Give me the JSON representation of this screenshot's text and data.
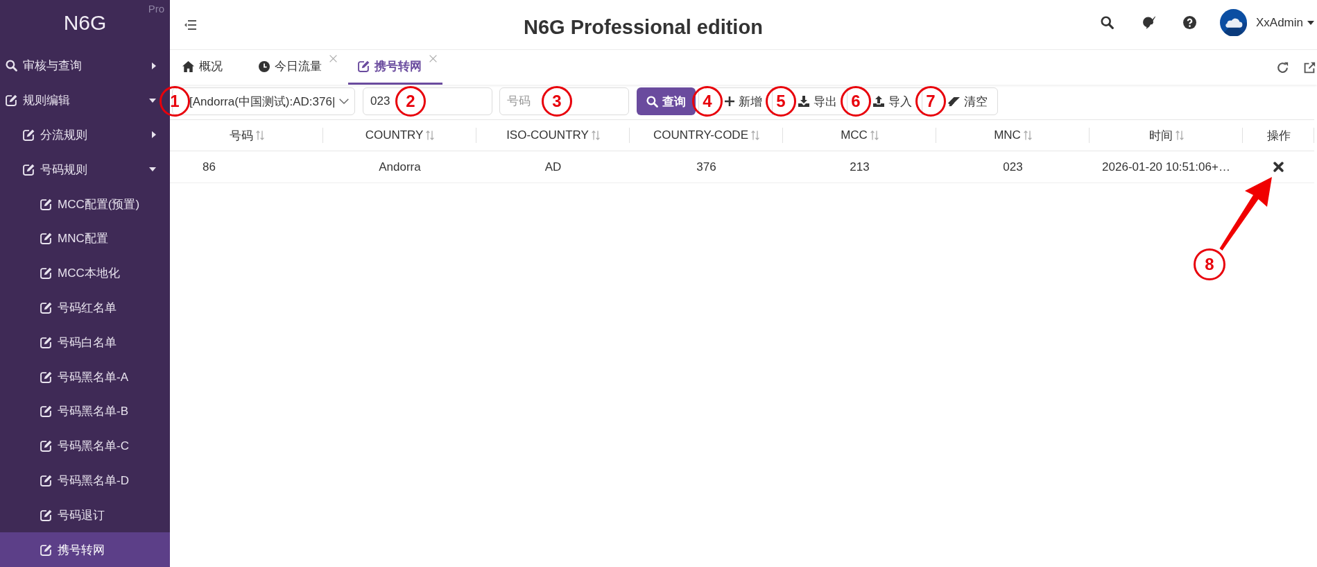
{
  "sidebar": {
    "logo": "N6G",
    "edition": "Pro",
    "items": [
      {
        "label": "审核与查询",
        "expanded": false,
        "selected": false
      },
      {
        "label": "规则编辑",
        "expanded": true,
        "selected": false,
        "children": [
          {
            "label": "分流规则",
            "expanded": false,
            "selected": false
          },
          {
            "label": "号码规则",
            "expanded": true,
            "selected": false,
            "children": [
              {
                "label": "MCC配置(预置)",
                "selected": false
              },
              {
                "label": "MNC配置",
                "selected": false
              },
              {
                "label": "MCC本地化",
                "selected": false
              },
              {
                "label": "号码红名单",
                "selected": false
              },
              {
                "label": "号码白名单",
                "selected": false
              },
              {
                "label": "号码黑名单-A",
                "selected": false
              },
              {
                "label": "号码黑名单-B",
                "selected": false
              },
              {
                "label": "号码黑名单-C",
                "selected": false
              },
              {
                "label": "号码黑名单-D",
                "selected": false
              },
              {
                "label": "号码退订",
                "selected": false
              },
              {
                "label": "携号转网",
                "selected": true
              }
            ]
          }
        ]
      }
    ]
  },
  "header": {
    "title": "N6G Professional edition",
    "user": "XxAdmin"
  },
  "tabs": [
    {
      "label": "概况",
      "selected": false,
      "closable": false
    },
    {
      "label": "今日流量",
      "selected": false,
      "closable": true
    },
    {
      "label": "携号转网",
      "selected": true,
      "closable": true
    }
  ],
  "toolbar": {
    "fields": [
      {
        "kind": "select",
        "value": "[Andorra(中国测试):AD:376|",
        "callout": "1"
      },
      {
        "kind": "input",
        "value": "023",
        "callout": "2"
      },
      {
        "kind": "input",
        "placeholder": "号码",
        "callout": "3"
      }
    ],
    "buttons": [
      {
        "kind": "primary",
        "label": "查询"
      },
      {
        "kind": "plain",
        "label": "新增",
        "callout": "4"
      },
      {
        "kind": "plain",
        "label": "导出",
        "callout": "5"
      },
      {
        "kind": "plain",
        "label": "导入",
        "callout": "6"
      },
      {
        "kind": "plain",
        "label": "清空",
        "callout": "7"
      }
    ]
  },
  "table": {
    "columns": [
      {
        "label": "号码",
        "sortable": true
      },
      {
        "label": "COUNTRY",
        "sortable": true
      },
      {
        "label": "ISO-COUNTRY",
        "sortable": true
      },
      {
        "label": "COUNTRY-CODE",
        "sortable": true
      },
      {
        "label": "MCC",
        "sortable": true
      },
      {
        "label": "MNC",
        "sortable": true
      },
      {
        "label": "时间",
        "sortable": true
      },
      {
        "label": "操作",
        "sortable": false
      }
    ],
    "rows": [
      {
        "cells": [
          "86",
          "Andorra",
          "AD",
          "376",
          "213",
          "023",
          "2026-01-20 10:51:06+…"
        ],
        "action_callout": "8"
      }
    ]
  }
}
